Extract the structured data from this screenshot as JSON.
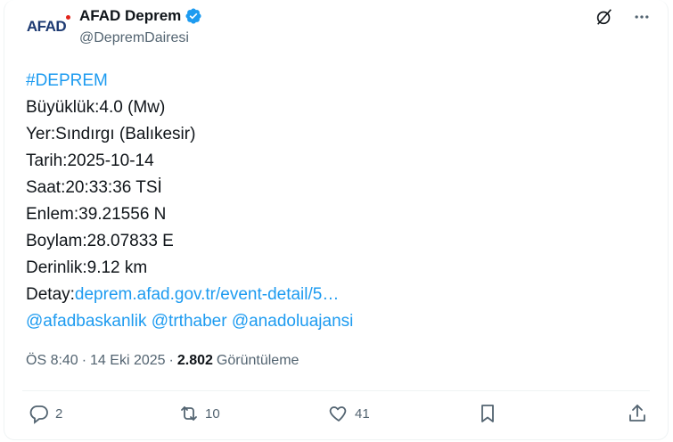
{
  "account": {
    "avatar_text": "AFAD",
    "display_name": "AFAD Deprem",
    "handle": "@DepremDairesi"
  },
  "icons": {
    "verified": "verified-badge-icon",
    "grok": "grok-icon",
    "more": "more-icon",
    "reply": "reply-icon",
    "retweet": "retweet-icon",
    "like": "like-icon",
    "bookmark": "bookmark-icon",
    "share": "share-icon"
  },
  "colors": {
    "link": "#1d9bf0",
    "verified": "#1d9bf0",
    "muted": "#536471",
    "text": "#0f1419",
    "brand": "#1d3a72",
    "brand_dot": "#e2231a"
  },
  "tweet": {
    "hashtag": "#DEPREM",
    "magnitude": "Büyüklük:4.0 (Mw)",
    "location": "Yer:Sındırgı (Balıkesir)",
    "date": "Tarih:2025-10-14",
    "time": "Saat:20:33:36 TSİ",
    "latitude": "Enlem:39.21556 N",
    "longitude": "Boylam:28.07833 E",
    "depth": "Derinlik:9.12 km",
    "detail_label": "Detay:",
    "detail_link": "deprem.afad.gov.tr/event-detail/5…",
    "mention_1": "@afadbaskanlik",
    "mention_2": "@trthaber",
    "mention_3": "@anadoluajansi"
  },
  "meta": {
    "time": "ÖS 8:40",
    "separator": "·",
    "date": "14 Eki 2025",
    "views_count": "2.802",
    "views_label": "Görüntüleme"
  },
  "actions": {
    "replies": "2",
    "retweets": "10",
    "likes": "41"
  }
}
